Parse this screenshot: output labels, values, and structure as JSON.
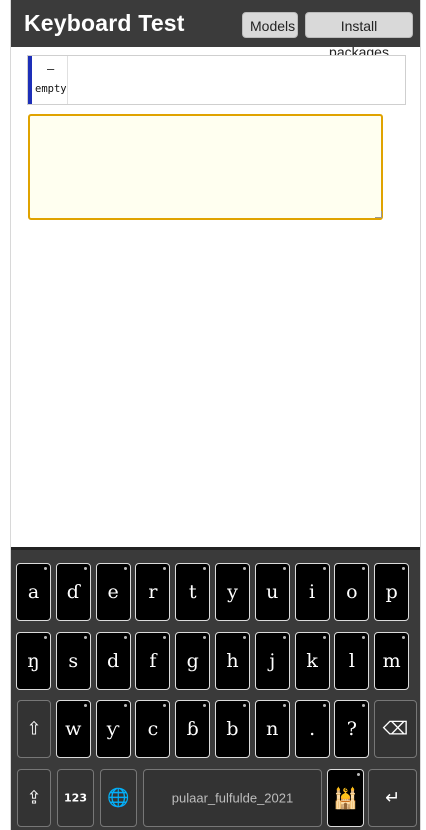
{
  "header": {
    "title": "Keyboard Test",
    "models_label": "Models",
    "install_label": "Install packages"
  },
  "status": {
    "dash": "–",
    "empty": "empty"
  },
  "textarea": {
    "value": ""
  },
  "keyboard": {
    "row1": [
      "a",
      "ɗ",
      "e",
      "r",
      "t",
      "y",
      "u",
      "i",
      "o",
      "p"
    ],
    "row2": [
      "ŋ",
      "s",
      "d",
      "f",
      "g",
      "h",
      "j",
      "k",
      "l",
      "m"
    ],
    "row3": [
      "w",
      "ƴ",
      "c",
      "ɓ",
      "b",
      "n",
      ".",
      "?"
    ],
    "shift_glyph": "⇧",
    "backspace_glyph": "⌫",
    "caps_glyph": "⇪",
    "numbers_label": "123",
    "globe_glyph": "🌐",
    "space_label": "pulaar_fulfulde_2021",
    "mosque_glyph": "🕌",
    "enter_glyph": "↵"
  }
}
